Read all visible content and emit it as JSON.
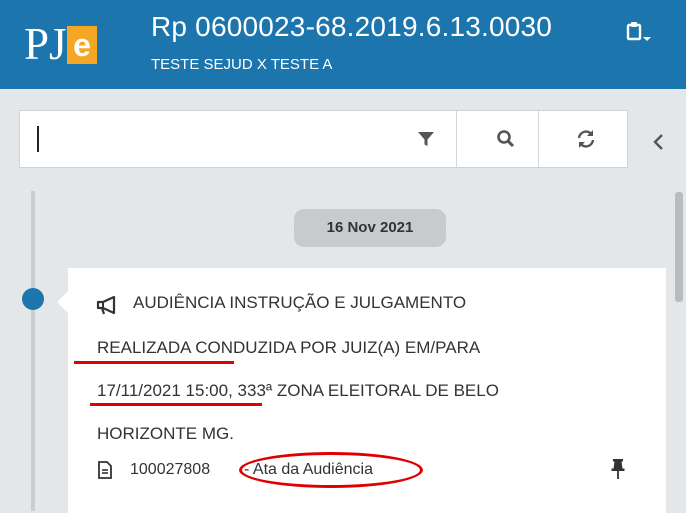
{
  "header": {
    "logo_letters": "PJe",
    "logo_p": "PJ",
    "logo_e": "e",
    "case_number": "Rp 0600023-68.2019.6.13.0030",
    "parties": "TESTE SEJUD X TESTE A",
    "copy_icon": "clipboard-icon",
    "background_color": "#1c75ad",
    "logo_accent_color": "#f5a623"
  },
  "search": {
    "value": "",
    "filter_icon": "filter-icon",
    "search_icon": "search-icon",
    "refresh_icon": "refresh-icon",
    "collapse_icon": "chevron-left-icon"
  },
  "timeline": {
    "date": "16 Nov 2021",
    "dot_color": "#1c75ad",
    "event": {
      "icon": "megaphone-icon",
      "lines": [
        "AUDIÊNCIA INSTRUÇÃO E JULGAMENTO",
        "REALIZADA CONDUZIDA POR JUIZ(A) EM/PARA",
        "17/11/2021 15:00, 333ª ZONA ELEITORAL DE BELO",
        "HORIZONTE MG."
      ],
      "document": {
        "icon": "document-icon",
        "id": "100027808",
        "title": "- Ata da Audiência",
        "pin_icon": "pin-icon"
      },
      "annotation_color": "#e00000"
    }
  }
}
